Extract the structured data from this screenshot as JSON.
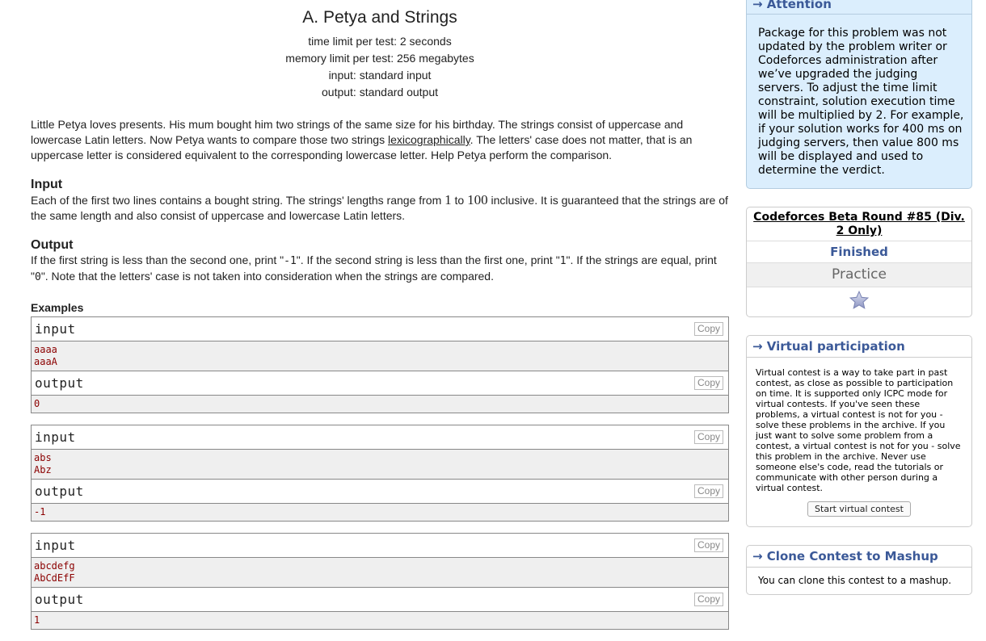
{
  "problem": {
    "title": "A. Petya and Strings",
    "time_limit": "time limit per test: 2 seconds",
    "memory_limit": "memory limit per test: 256 megabytes",
    "input_file": "input: standard input",
    "output_file": "output: standard output",
    "legend_pre": "Little Petya loves presents. His mum bought him two strings of the same size for his birthday. The strings consist of uppercase and lowercase Latin letters. Now Petya wants to compare those two strings ",
    "legend_link": "lexicographically",
    "legend_post": ". The letters' case does not matter, that is an uppercase letter is considered equivalent to the corresponding lowercase letter. Help Petya perform the comparison.",
    "input_title": "Input",
    "input_pre": "Each of the first two lines contains a bought string. The strings' lengths range from ",
    "input_min": "1",
    "input_mid": " to ",
    "input_max": "100",
    "input_post": " inclusive. It is guaranteed that the strings are of the same length and also consist of uppercase and lowercase Latin letters.",
    "output_title": "Output",
    "output_text_1": "If the first string is less than the second one, print \"",
    "output_code_1": "-1",
    "output_text_2": "\". If the second string is less than the first one, print \"",
    "output_code_2": "1",
    "output_text_3": "\". If the strings are equal, print \"",
    "output_code_3": "0",
    "output_text_4": "\". Note that the letters' case is not taken into consideration when the strings are compared.",
    "examples_title": "Examples",
    "input_label": "input",
    "output_label": "output",
    "copy_label": "Copy",
    "examples": [
      {
        "in1": "aaaa",
        "in2": "aaaA",
        "out": "0"
      },
      {
        "in1": "abs",
        "in2": "Abz",
        "out": "-1"
      },
      {
        "in1": "abcdefg",
        "in2": "AbCdEfF",
        "out": "1"
      }
    ]
  },
  "sidebar": {
    "attention_title": "→ Attention",
    "attention_text": "Package for this problem was not updated by the problem writer or Codeforces administration after we’ve upgraded the judging servers. To adjust the time limit constraint, solution execution time will be multiplied by 2. For example, if your solution works for 400 ms on judging servers, then value 800 ms will be displayed and used to determine the verdict.",
    "contest_name": "Codeforces Beta Round #85 (Div. 2 Only)",
    "contest_status": "Finished",
    "contest_phase": "Practice",
    "virtual_title": "→ Virtual participation",
    "virtual_text": "Virtual contest is a way to take part in past contest, as close as possible to participation on time. It is supported only ICPC mode for virtual contests. If you've seen these problems, a virtual contest is not for you - solve these problems in the archive. If you just want to solve some problem from a contest, a virtual contest is not for you - solve this problem in the archive. Never use someone else's code, read the tutorials or communicate with other person during a virtual contest.",
    "virtual_button": "Start virtual contest",
    "clone_title": "→ Clone Contest to Mashup",
    "clone_text": "You can clone this contest to a mashup.",
    "star_icon": "star-icon",
    "accent_color": "#3b5998",
    "attention_bg": "#dbeefd"
  }
}
